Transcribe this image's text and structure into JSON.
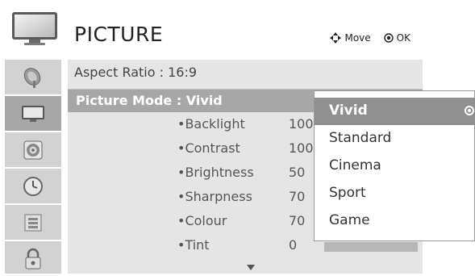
{
  "header": {
    "title": "PICTURE",
    "hint_move": "Move",
    "hint_ok": "OK"
  },
  "sidebar": {
    "items": [
      {
        "icon": "satellite-dish-icon",
        "active": false
      },
      {
        "icon": "tv-screen-icon",
        "active": true
      },
      {
        "icon": "speaker-icon",
        "active": false
      },
      {
        "icon": "clock-icon",
        "active": false
      },
      {
        "icon": "options-icon",
        "active": false
      },
      {
        "icon": "lock-icon",
        "active": false
      }
    ]
  },
  "menu": {
    "aspect_ratio": "Aspect Ratio   : 16:9",
    "picture_mode": "Picture Mode : Vivid",
    "settings": [
      {
        "label": "Backlight",
        "value": "100"
      },
      {
        "label": "Contrast",
        "value": "100"
      },
      {
        "label": "Brightness",
        "value": "50"
      },
      {
        "label": "Sharpness",
        "value": "70"
      },
      {
        "label": "Colour",
        "value": "70"
      },
      {
        "label": "Tint",
        "value": "0"
      }
    ]
  },
  "dropdown": {
    "options": [
      "Vivid",
      "Standard",
      "Cinema",
      "Sport",
      "Game"
    ],
    "selected": "Vivid"
  },
  "colors": {
    "sidebar_bg": "#d2d2d2",
    "active_bg": "#a7a7a7",
    "panel_bg": "#e5e5e5",
    "selected_option_bg": "#8f8f8f"
  }
}
